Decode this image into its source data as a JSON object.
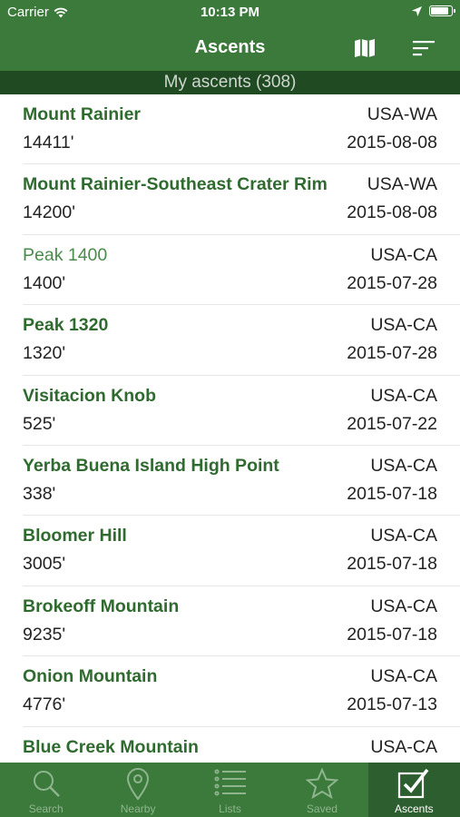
{
  "status_bar": {
    "carrier": "Carrier",
    "time": "10:13 PM",
    "battery_level": 0.9
  },
  "nav": {
    "title": "Ascents",
    "map_icon": "map-icon",
    "sort_icon": "sort-icon"
  },
  "section": {
    "header": "My ascents (308)"
  },
  "ascents": [
    {
      "name": "Mount Rainier",
      "state": "USA-WA",
      "elevation": "14411'",
      "date": "2015-08-08",
      "bold": true
    },
    {
      "name": "Mount Rainier-Southeast Crater Rim",
      "state": "USA-WA",
      "elevation": "14200'",
      "date": "2015-08-08",
      "bold": true
    },
    {
      "name": "Peak 1400",
      "state": "USA-CA",
      "elevation": "1400'",
      "date": "2015-07-28",
      "bold": false
    },
    {
      "name": "Peak 1320",
      "state": "USA-CA",
      "elevation": "1320'",
      "date": "2015-07-28",
      "bold": true
    },
    {
      "name": "Visitacion Knob",
      "state": "USA-CA",
      "elevation": "525'",
      "date": "2015-07-22",
      "bold": true
    },
    {
      "name": "Yerba Buena Island High Point",
      "state": "USA-CA",
      "elevation": "338'",
      "date": "2015-07-18",
      "bold": true
    },
    {
      "name": "Bloomer Hill",
      "state": "USA-CA",
      "elevation": "3005'",
      "date": "2015-07-18",
      "bold": true
    },
    {
      "name": "Brokeoff Mountain",
      "state": "USA-CA",
      "elevation": "9235'",
      "date": "2015-07-18",
      "bold": true
    },
    {
      "name": "Onion Mountain",
      "state": "USA-CA",
      "elevation": "4776'",
      "date": "2015-07-13",
      "bold": true
    },
    {
      "name": "Blue Creek Mountain",
      "state": "USA-CA",
      "elevation": "",
      "date": "",
      "bold": true
    }
  ],
  "tabs": [
    {
      "label": "Search",
      "icon": "search-icon",
      "active": false
    },
    {
      "label": "Nearby",
      "icon": "location-pin-icon",
      "active": false
    },
    {
      "label": "Lists",
      "icon": "list-icon",
      "active": false
    },
    {
      "label": "Saved",
      "icon": "star-icon",
      "active": false
    },
    {
      "label": "Ascents",
      "icon": "checkbox-icon",
      "active": true
    }
  ],
  "colors": {
    "bar_green": "#3c7a3c",
    "header_dark_green": "#1f4a22",
    "name_green": "#2f6a2f"
  }
}
